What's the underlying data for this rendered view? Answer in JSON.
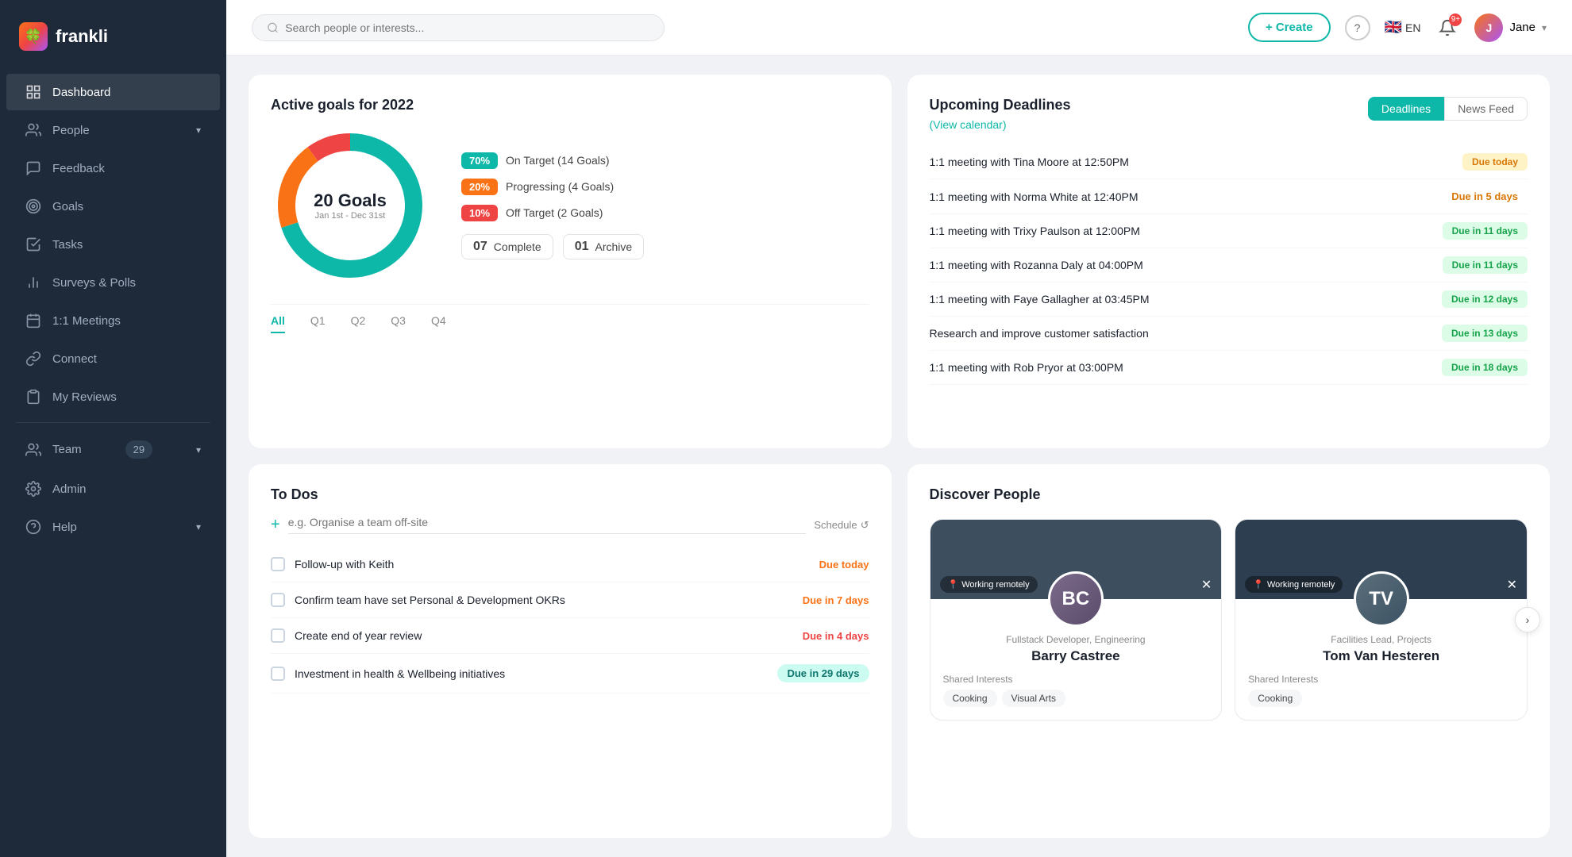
{
  "sidebar": {
    "logo_text": "frankli",
    "nav_items": [
      {
        "id": "dashboard",
        "label": "Dashboard",
        "icon": "grid",
        "active": true
      },
      {
        "id": "people",
        "label": "People",
        "icon": "users",
        "has_chevron": true
      },
      {
        "id": "feedback",
        "label": "Feedback",
        "icon": "message"
      },
      {
        "id": "goals",
        "label": "Goals",
        "icon": "target"
      },
      {
        "id": "tasks",
        "label": "Tasks",
        "icon": "check-square"
      },
      {
        "id": "surveys",
        "label": "Surveys & Polls",
        "icon": "bar-chart"
      },
      {
        "id": "meetings",
        "label": "1:1 Meetings",
        "icon": "calendar"
      },
      {
        "id": "connect",
        "label": "Connect",
        "icon": "link"
      },
      {
        "id": "myreviews",
        "label": "My Reviews",
        "icon": "clipboard"
      },
      {
        "id": "team",
        "label": "Team",
        "icon": "team",
        "badge": "29",
        "has_chevron": true
      },
      {
        "id": "admin",
        "label": "Admin",
        "icon": "settings"
      },
      {
        "id": "help",
        "label": "Help",
        "icon": "help",
        "has_chevron": true
      }
    ]
  },
  "topbar": {
    "search_placeholder": "Search people or interests...",
    "create_label": "+ Create",
    "lang": "EN",
    "notif_count": "9+",
    "user_name": "Jane"
  },
  "goals": {
    "title": "Active goals for 2022",
    "donut_center_number": "20 Goals",
    "donut_center_date": "Jan 1st - Dec 31st",
    "on_target_pct": "70%",
    "on_target_label": "On Target (14 Goals)",
    "progressing_pct": "20%",
    "progressing_label": "Progressing (4 Goals)",
    "off_target_pct": "10%",
    "off_target_label": "Off Target (2 Goals)",
    "complete_count": "07",
    "complete_label": "Complete",
    "archive_count": "01",
    "archive_label": "Archive",
    "tabs": [
      "All",
      "Q1",
      "Q2",
      "Q3",
      "Q4"
    ],
    "active_tab": "All"
  },
  "deadlines": {
    "title": "Upcoming Deadlines",
    "view_calendar": "(View calendar)",
    "tabs": [
      "Deadlines",
      "News Feed"
    ],
    "active_tab": "Deadlines",
    "items": [
      {
        "name": "1:1 meeting with Tina Moore at 12:50PM",
        "due": "Due today",
        "due_class": "due-today"
      },
      {
        "name": "1:1 meeting with Norma White at 12:40PM",
        "due": "Due in 5 days",
        "due_class": "due-5"
      },
      {
        "name": "1:1 meeting with Trixy Paulson at 12:00PM",
        "due": "Due in 11 days",
        "due_class": "due-11"
      },
      {
        "name": "1:1 meeting with Rozanna Daly at 04:00PM",
        "due": "Due in 11 days",
        "due_class": "due-11"
      },
      {
        "name": "1:1 meeting with Faye Gallagher at 03:45PM",
        "due": "Due in 12 days",
        "due_class": "due-12"
      },
      {
        "name": "Research and improve customer satisfaction",
        "due": "Due in 13 days",
        "due_class": "due-13"
      },
      {
        "name": "1:1 meeting with Rob Pryor at 03:00PM",
        "due": "Due in 18 days",
        "due_class": "due-18"
      }
    ]
  },
  "todos": {
    "title": "To Dos",
    "input_placeholder": "e.g. Organise a team off-site",
    "schedule_label": "Schedule",
    "items": [
      {
        "text": "Follow-up with Keith",
        "due": "Due today",
        "due_class": "due-orange"
      },
      {
        "text": "Confirm team have set Personal & Development OKRs",
        "due": "Due in 7 days",
        "due_class": "due-orange"
      },
      {
        "text": "Create end of year review",
        "due": "Due in 4 days",
        "due_class": "due-red"
      },
      {
        "text": "Investment in health & Wellbeing initiatives",
        "due": "Due in 29 days",
        "due_class": "due-teal"
      }
    ]
  },
  "discover_people": {
    "title": "Discover People",
    "people": [
      {
        "name": "Barry Castree",
        "role": "Fullstack Developer, Engineering",
        "working_status": "Working remotely",
        "avatar_color": "#7c6b8a",
        "avatar_initials": "BC",
        "shared_interests_label": "Shared Interests",
        "interests": [
          "Cooking",
          "Visual Arts"
        ]
      },
      {
        "name": "Tom Van Hesteren",
        "role": "Facilities Lead, Projects",
        "working_status": "Working remotely",
        "avatar_color": "#5b6f7c",
        "avatar_initials": "TV",
        "shared_interests_label": "Shared Interests",
        "interests": [
          "Cooking"
        ]
      }
    ]
  }
}
